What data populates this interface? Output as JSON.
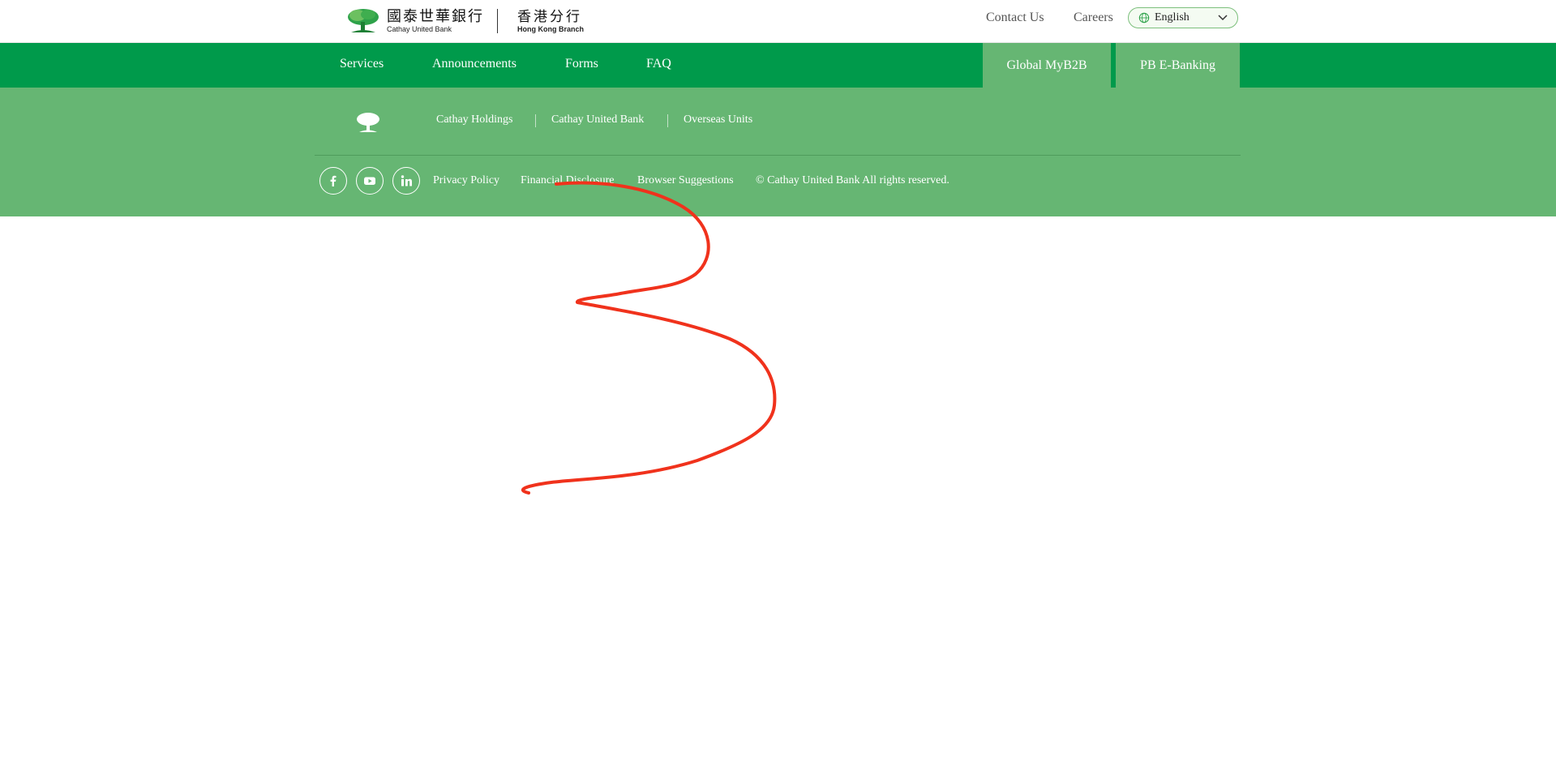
{
  "header": {
    "logo_zh": "國泰世華銀行",
    "logo_en": "Cathay United Bank",
    "branch_zh": "香港分行",
    "branch_en": "Hong Kong Branch",
    "contact_label": "Contact Us",
    "careers_label": "Careers",
    "language": {
      "selected": "English",
      "icon": "globe-icon"
    }
  },
  "nav": {
    "items": [
      "Services",
      "Announcements",
      "Forms",
      "FAQ"
    ],
    "buttons": [
      "Global MyB2B",
      "PB E-Banking"
    ]
  },
  "footer": {
    "group_links": [
      "Cathay Holdings",
      "Cathay United Bank",
      "Overseas Units"
    ],
    "social": [
      "facebook-icon",
      "youtube-icon",
      "linkedin-icon"
    ],
    "bottom_links": [
      "Privacy Policy",
      "Financial Disclosure",
      "Browser Suggestions"
    ],
    "copyright": "© Cathay United Bank All rights reserved."
  },
  "colors": {
    "nav_green": "#009a4b",
    "footer_green": "#66b673",
    "button_green": "#66b673",
    "annotation_red": "#f0321c"
  }
}
